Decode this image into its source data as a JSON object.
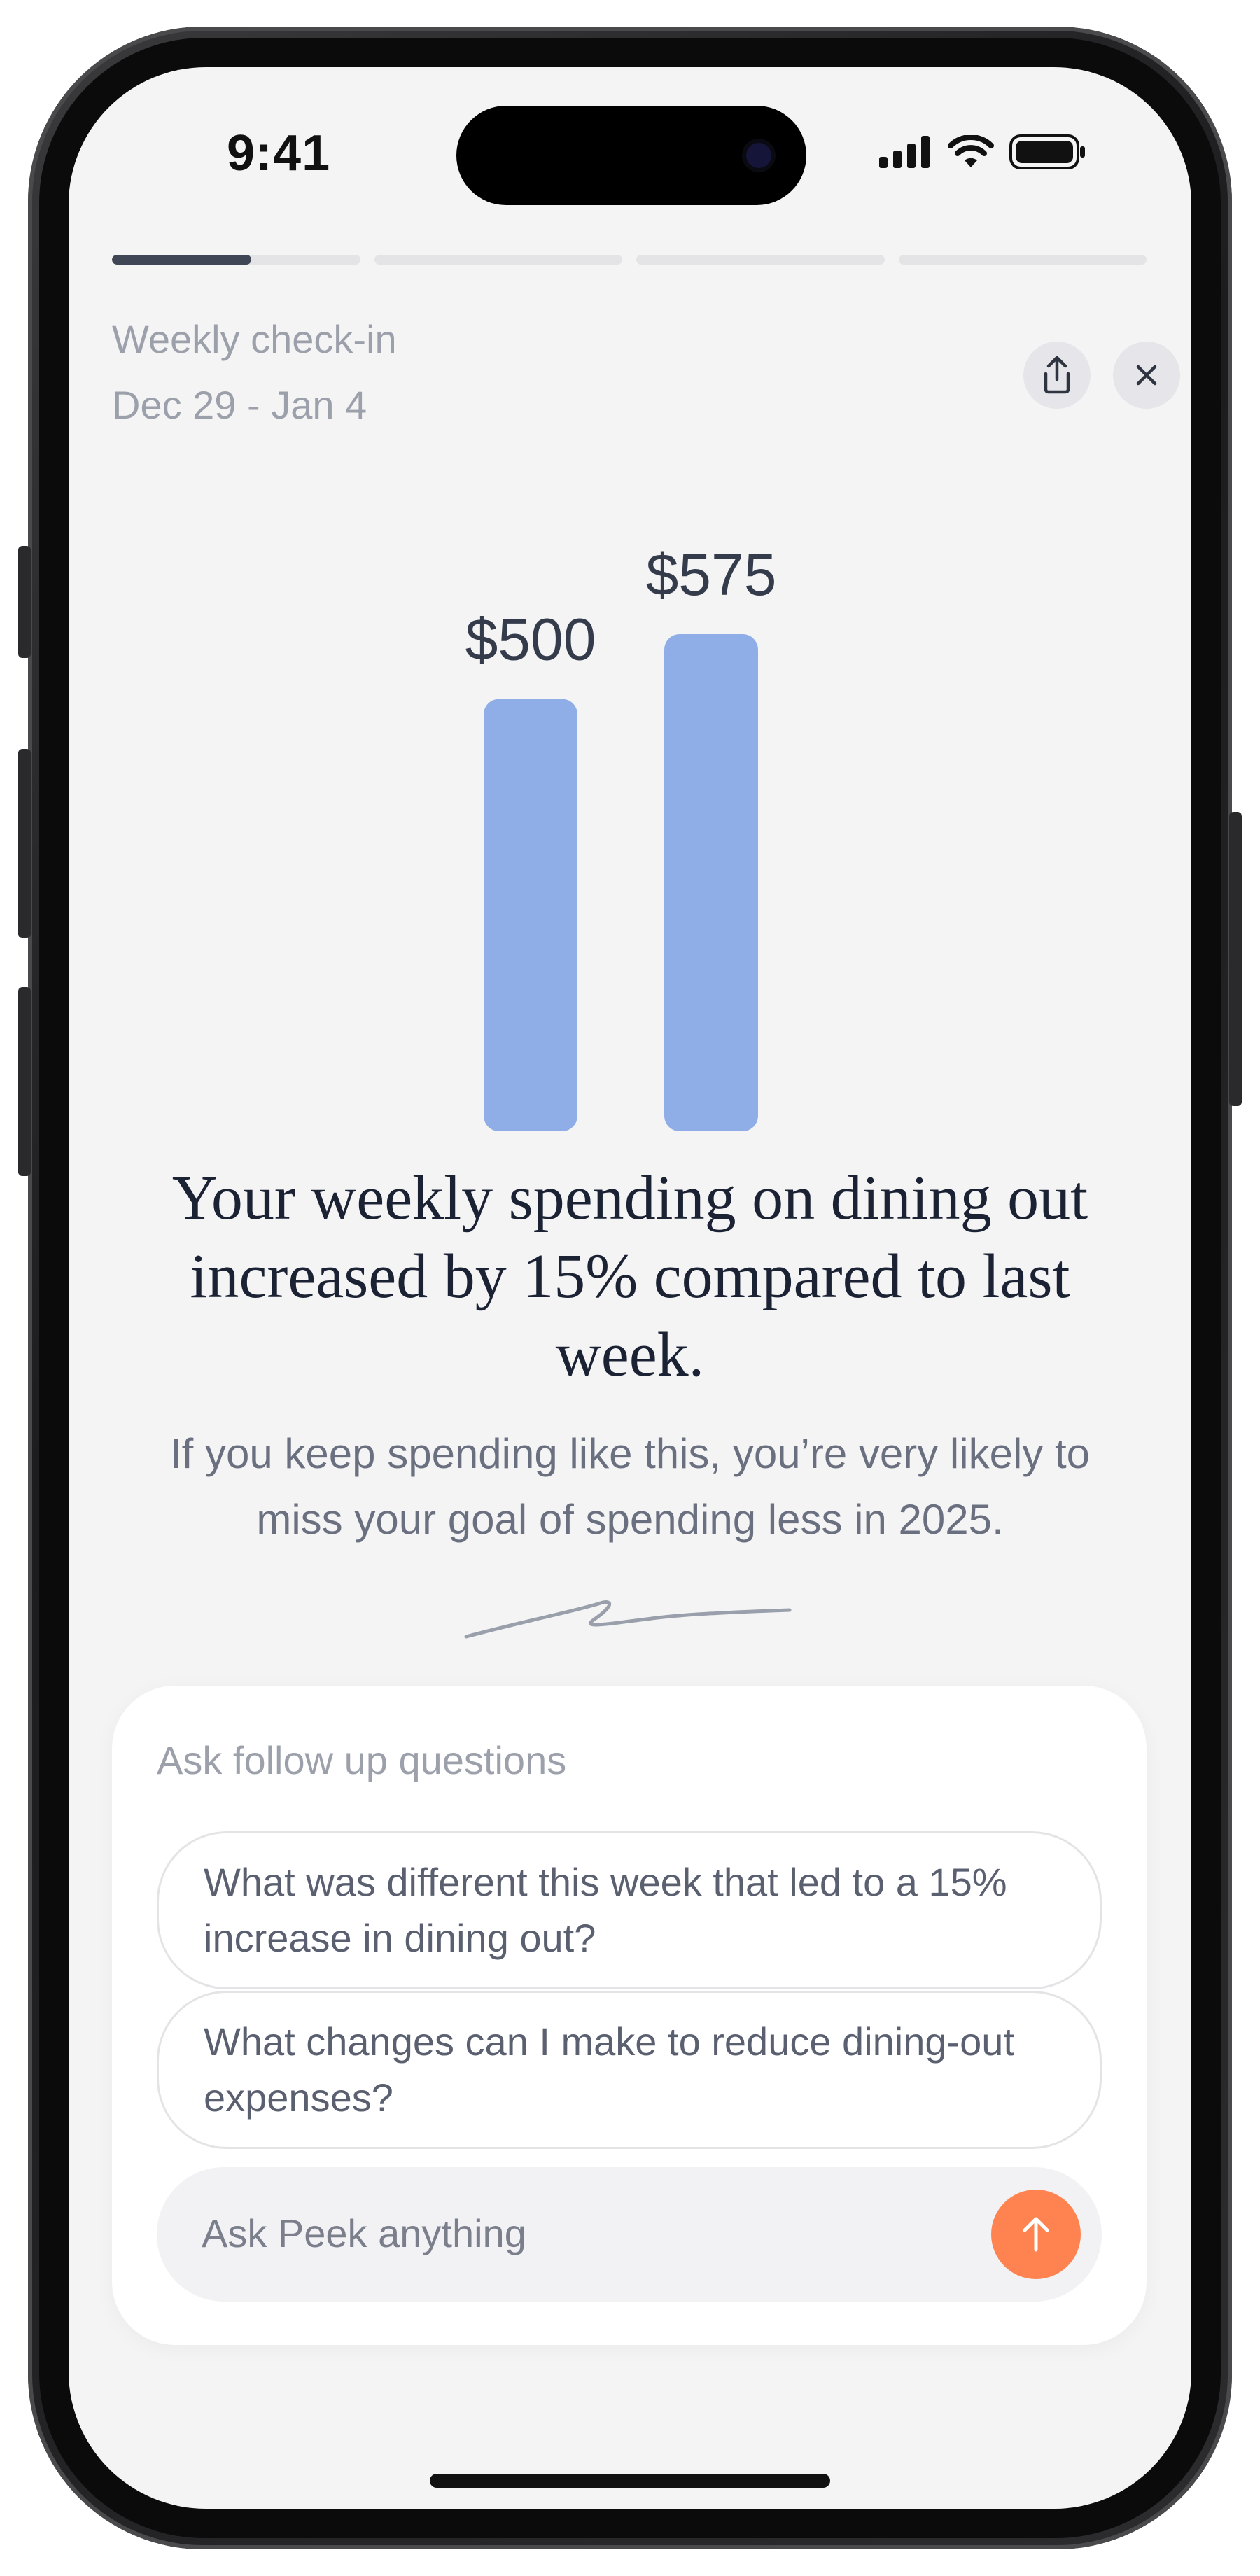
{
  "status_bar": {
    "time": "9:41"
  },
  "progress": {
    "segments": 4,
    "active_fraction": 0.56
  },
  "header": {
    "title": "Weekly check-in",
    "date_range": "Dec 29 - Jan 4",
    "share_icon": "share-icon",
    "close_icon": "close-icon"
  },
  "chart_data": {
    "type": "bar",
    "categories": [
      "",
      ""
    ],
    "values": [
      500,
      575
    ],
    "data_labels": [
      "$500",
      "$575"
    ],
    "color": "#8fade6"
  },
  "headline": "Your weekly spending on dining out increased by 15% compared to last week.",
  "subtext": "If you keep spending like this, you’re very likely to miss your goal of spending less in 2025.",
  "followup": {
    "title": "Ask follow up questions",
    "suggestions": [
      "What was different this week that led to a 15% increase in dining out?",
      "What changes can I make to reduce dining-out expenses?"
    ],
    "input_placeholder": "Ask Peek anything",
    "send_icon": "arrow-up-icon"
  },
  "colors": {
    "accent": "#ff8350",
    "bar": "#8fade6",
    "progress_active": "#3f4756"
  }
}
